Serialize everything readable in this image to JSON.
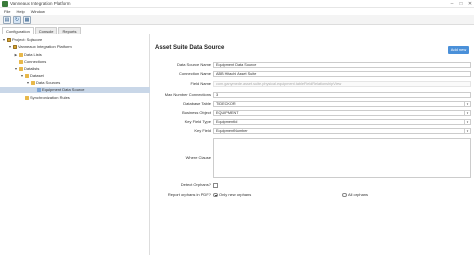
{
  "window": {
    "title": "Vanneaux Integration Platform",
    "minimize": "–",
    "maximize": "□",
    "close": "✕"
  },
  "menu": [
    "File",
    "Help",
    "Window"
  ],
  "toolbar": {
    "icons": [
      "folder-icon",
      "refresh-icon",
      "grid-icon"
    ]
  },
  "tabs": [
    {
      "label": "Configuration",
      "active": true
    },
    {
      "label": "Console",
      "active": false
    },
    {
      "label": "Reports",
      "active": false
    }
  ],
  "tree": [
    {
      "label": "Project: Sqlscore",
      "toggle": "▼",
      "icon": "project"
    },
    {
      "label": "Vanneaux Integration Platform",
      "toggle": "▼",
      "icon": "project"
    },
    {
      "label": "Data Lists",
      "toggle": "▶",
      "icon": "folder"
    },
    {
      "label": "Connections",
      "toggle": "",
      "icon": "folder"
    },
    {
      "label": "Datalists",
      "toggle": "▼",
      "icon": "folder"
    },
    {
      "label": "Dataset",
      "toggle": "▼",
      "icon": "folder"
    },
    {
      "label": "Data Sources",
      "toggle": "▼",
      "icon": "folder"
    },
    {
      "label": "Equipment Data Source",
      "toggle": "",
      "icon": "ds",
      "selected": true
    },
    {
      "label": "Synchronization Rules",
      "toggle": "",
      "icon": "folder"
    }
  ],
  "form": {
    "title": "Asset Suite Data Source",
    "add_button": "Add new",
    "data_source_name": {
      "label": "Data Source Name",
      "value": "Equipment Data Source"
    },
    "connection_name": {
      "label": "Connection Name",
      "value": "ABB Hitachi Asset Suite"
    },
    "field_name": {
      "label": "Field Name",
      "value": "com.ganymede.asset.suite.physical.equipment.tableFieldRelationshipView"
    },
    "max_connections": {
      "label": "Max Number Connections",
      "value": "3"
    },
    "database_table": {
      "label": "Database Table",
      "value": "TIDECKOR"
    },
    "business_object": {
      "label": "Business Object",
      "value": "EQUIPMENT"
    },
    "key_field_type": {
      "label": "Key Field Type",
      "value": "EquipmentId"
    },
    "key_field": {
      "label": "Key Field",
      "value": "EquipmentNumber"
    },
    "where_clause": {
      "label": "Where Clause",
      "value": ""
    },
    "detect_orphans": {
      "label": "Detect Orphans?"
    },
    "report_orphans": {
      "label": "Report orphans in PDF?",
      "options": [
        {
          "label": "Only new orphans",
          "selected": true
        },
        {
          "label": "All orphans",
          "selected": false
        }
      ]
    }
  },
  "colors": {
    "accent": "#4a90d9",
    "selection": "#c9d7e8",
    "folder": "#e8b84a"
  }
}
